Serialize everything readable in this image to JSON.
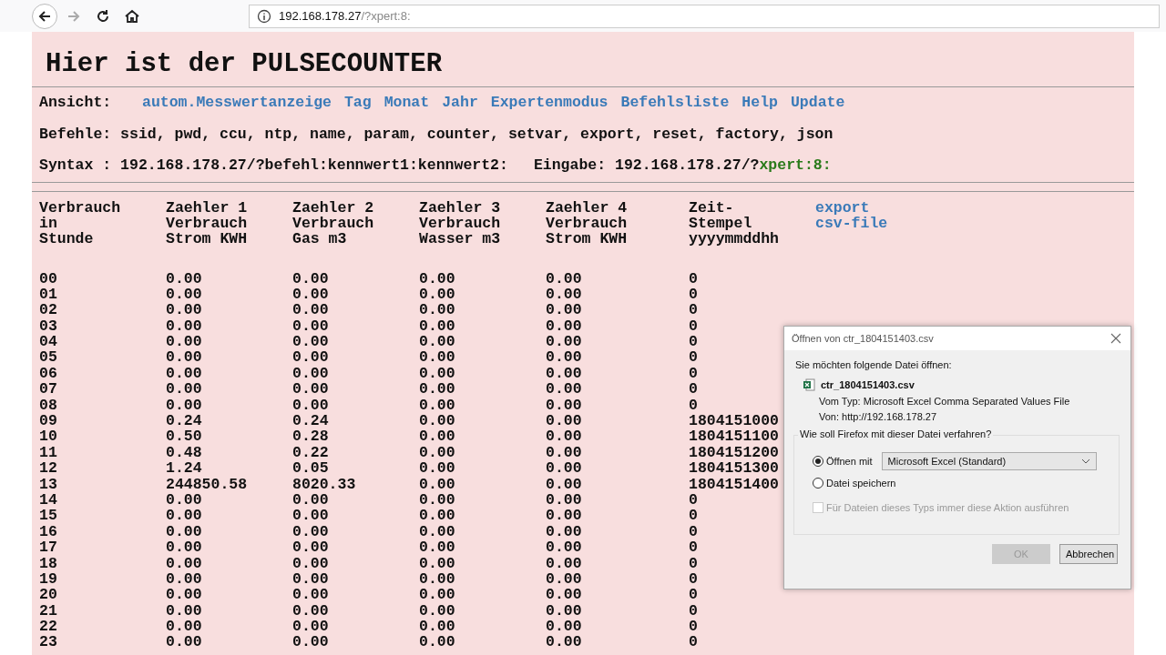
{
  "browser": {
    "forward_disabled": true,
    "url_host": "192.168.178.27",
    "url_path": "/?xpert:8:"
  },
  "page": {
    "title": "Hier ist der PULSECOUNTER",
    "view_label": "Ansicht:",
    "nav_links": [
      "autom.Messwertanzeige",
      "Tag",
      "Monat",
      "Jahr",
      "Expertenmodus",
      "Befehlsliste",
      "Help",
      "Update"
    ],
    "commands": "Befehle: ssid, pwd, ccu, ntp, name, param, counter, setvar, export, reset, factory, json",
    "syntax": "Syntax : 192.168.178.27/?befehl:kennwert1:kennwert2:",
    "input_label": "Eingabe: 192.168.178.27/?",
    "input_value": "xpert:8:"
  },
  "table": {
    "columns": [
      "Verbrauch\nin\nStunde",
      "Zaehler 1\nVerbrauch\nStrom KWH",
      "Zaehler 2\nVerbrauch\nGas m3",
      "Zaehler 3\nVerbrauch\nWasser m3",
      "Zaehler 4\nVerbrauch\nStrom KWH",
      "Zeit-\nStempel\nyyyymmddhh"
    ],
    "export_link": "export csv-file",
    "rows": [
      [
        "00",
        "0.00",
        "0.00",
        "0.00",
        "0.00",
        "0"
      ],
      [
        "01",
        "0.00",
        "0.00",
        "0.00",
        "0.00",
        "0"
      ],
      [
        "02",
        "0.00",
        "0.00",
        "0.00",
        "0.00",
        "0"
      ],
      [
        "03",
        "0.00",
        "0.00",
        "0.00",
        "0.00",
        "0"
      ],
      [
        "04",
        "0.00",
        "0.00",
        "0.00",
        "0.00",
        "0"
      ],
      [
        "05",
        "0.00",
        "0.00",
        "0.00",
        "0.00",
        "0"
      ],
      [
        "06",
        "0.00",
        "0.00",
        "0.00",
        "0.00",
        "0"
      ],
      [
        "07",
        "0.00",
        "0.00",
        "0.00",
        "0.00",
        "0"
      ],
      [
        "08",
        "0.00",
        "0.00",
        "0.00",
        "0.00",
        "0"
      ],
      [
        "09",
        "0.24",
        "0.24",
        "0.00",
        "0.00",
        "1804151000"
      ],
      [
        "10",
        "0.50",
        "0.28",
        "0.00",
        "0.00",
        "1804151100"
      ],
      [
        "11",
        "0.48",
        "0.22",
        "0.00",
        "0.00",
        "1804151200"
      ],
      [
        "12",
        "1.24",
        "0.05",
        "0.00",
        "0.00",
        "1804151300"
      ],
      [
        "13",
        "244850.58",
        "8020.33",
        "0.00",
        "0.00",
        "1804151400"
      ],
      [
        "14",
        "0.00",
        "0.00",
        "0.00",
        "0.00",
        "0"
      ],
      [
        "15",
        "0.00",
        "0.00",
        "0.00",
        "0.00",
        "0"
      ],
      [
        "16",
        "0.00",
        "0.00",
        "0.00",
        "0.00",
        "0"
      ],
      [
        "17",
        "0.00",
        "0.00",
        "0.00",
        "0.00",
        "0"
      ],
      [
        "18",
        "0.00",
        "0.00",
        "0.00",
        "0.00",
        "0"
      ],
      [
        "19",
        "0.00",
        "0.00",
        "0.00",
        "0.00",
        "0"
      ],
      [
        "20",
        "0.00",
        "0.00",
        "0.00",
        "0.00",
        "0"
      ],
      [
        "21",
        "0.00",
        "0.00",
        "0.00",
        "0.00",
        "0"
      ],
      [
        "22",
        "0.00",
        "0.00",
        "0.00",
        "0.00",
        "0"
      ],
      [
        "23",
        "0.00",
        "0.00",
        "0.00",
        "0.00",
        "0"
      ]
    ]
  },
  "dialog": {
    "title": "Öffnen von ctr_1804151403.csv",
    "intro": "Sie möchten folgende Datei öffnen:",
    "file_name": "ctr_1804151403.csv",
    "type_label": "Vom Typ:",
    "type_value": "Microsoft Excel Comma Separated Values File",
    "from_label": "Von:",
    "from_value": "http://192.168.178.27",
    "group_label": "Wie soll Firefox mit dieser Datei verfahren?",
    "options": [
      {
        "label": "Öffnen mit",
        "selected": true
      },
      {
        "label": "Datei speichern",
        "selected": false
      }
    ],
    "app_select": "Microsoft Excel (Standard)",
    "remember": {
      "label": "Für Dateien dieses Typs immer diese Aktion ausführen",
      "checked": false,
      "disabled": true
    },
    "buttons": [
      {
        "label": "OK",
        "disabled": true
      },
      {
        "label": "Abbrechen",
        "disabled": false
      }
    ]
  }
}
